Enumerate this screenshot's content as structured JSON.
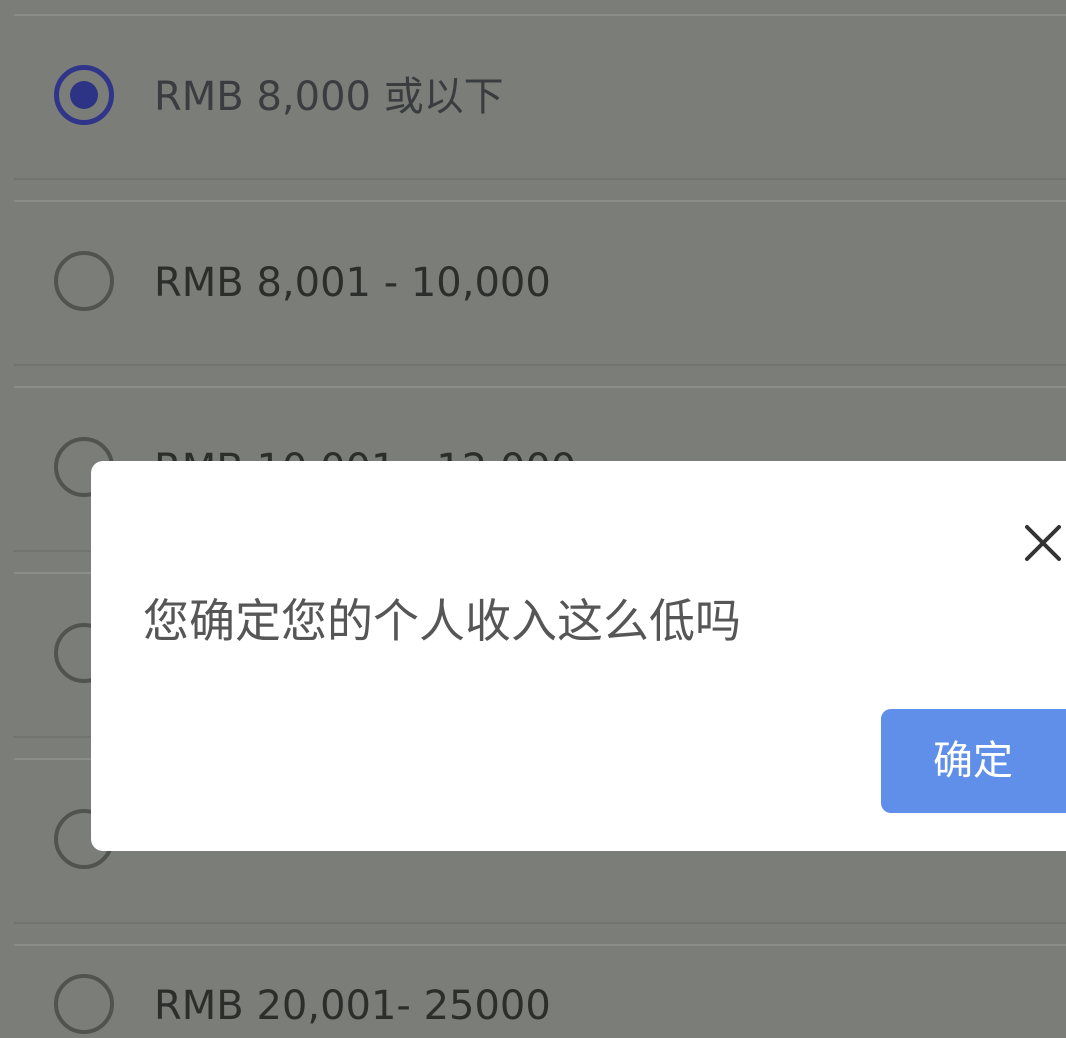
{
  "options": [
    {
      "label": "RMB 8,000 或以下",
      "checked": true
    },
    {
      "label": "RMB 8,001 - 10,000",
      "checked": false
    },
    {
      "label": "RMB 10,001 - 12,000",
      "checked": false
    },
    {
      "label": "",
      "checked": false
    },
    {
      "label": "",
      "checked": false
    },
    {
      "label": "RMB 20,001- 25000",
      "checked": false
    }
  ],
  "dialog": {
    "message": "您确定您的个人收入这么低吗",
    "confirm_label": "确定",
    "close_icon": "close-icon"
  },
  "colors": {
    "overlay_background": "#7b7e78",
    "radio_checked": "#2d3385",
    "dialog_background": "#ffffff",
    "confirm_button": "#5f8fe8"
  }
}
